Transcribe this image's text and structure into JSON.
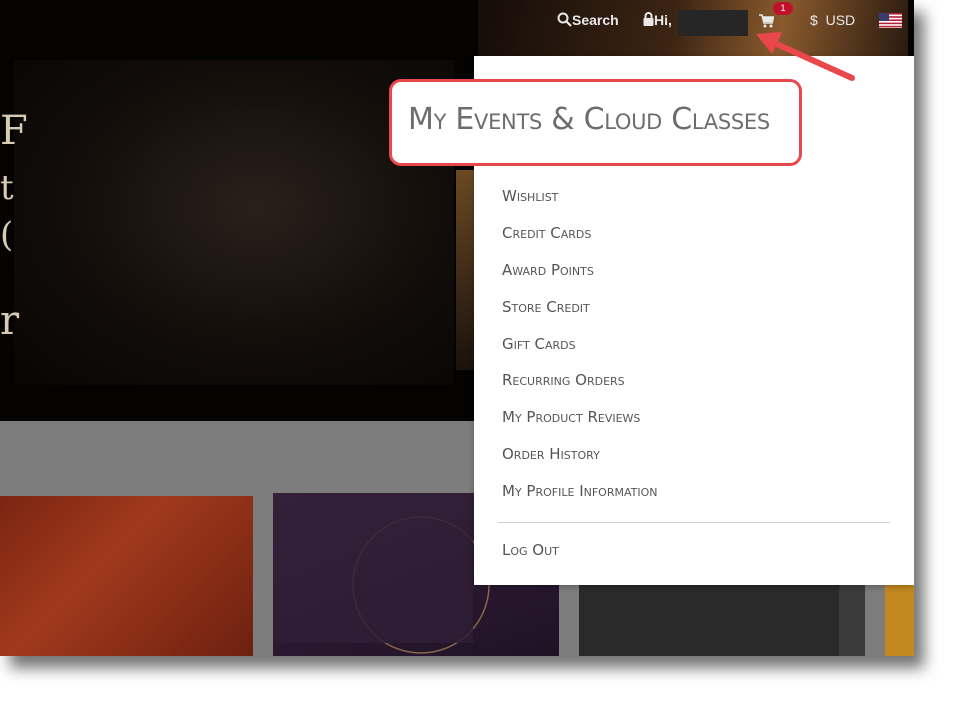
{
  "topbar": {
    "search_label": "Search",
    "greeting": "Hi,",
    "cart_count": "1",
    "currency_symbol": "$",
    "currency": "USD"
  },
  "account_menu": {
    "highlighted_item": "My Events & Cloud Classes",
    "items": [
      "Wishlist",
      "Credit Cards",
      "Award Points",
      "Store Credit",
      "Gift Cards",
      "Recurring Orders",
      "My Product Reviews",
      "Order History",
      "My Profile Information"
    ],
    "logout": "Log Out"
  },
  "colors": {
    "highlight_border": "#e8474b",
    "arrow": "#e8474b",
    "cart_badge": "#c0112b"
  }
}
